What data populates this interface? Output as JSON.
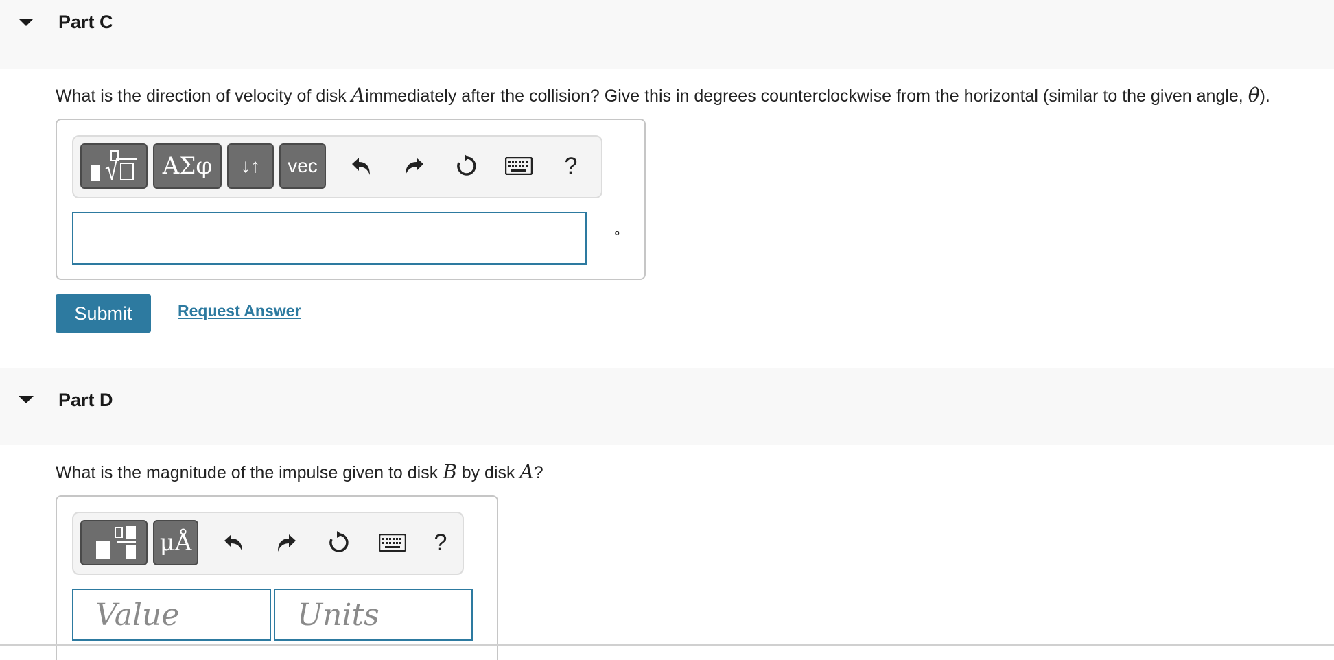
{
  "partC": {
    "title": "Part C",
    "question_pre": "What is the direction of velocity of disk ",
    "question_var": "A",
    "question_post": "immediately after the collision?  Give this in degrees counterclockwise from the horizontal (similar to the given angle, ",
    "question_theta": "θ",
    "question_end": ").",
    "toolbar": {
      "greek_label": "ΑΣφ",
      "arrows_label": "↓↑",
      "vec_label": "vec",
      "help_label": "?"
    },
    "input_value": "",
    "unit_symbol": "∘",
    "submit_label": "Submit",
    "request_label": "Request Answer"
  },
  "partD": {
    "title": "Part D",
    "question_pre": "What is the magnitude of the impulse given to disk ",
    "question_var1": "B",
    "question_mid": " by disk ",
    "question_var2": "A",
    "question_end": "?",
    "toolbar": {
      "units_label": "μÅ",
      "help_label": "?"
    },
    "value_placeholder": "Value",
    "units_placeholder": "Units"
  },
  "colors": {
    "accent": "#2d7aa0",
    "header_bg": "#f8f8f8",
    "tool_button": "#6d6d6d"
  }
}
